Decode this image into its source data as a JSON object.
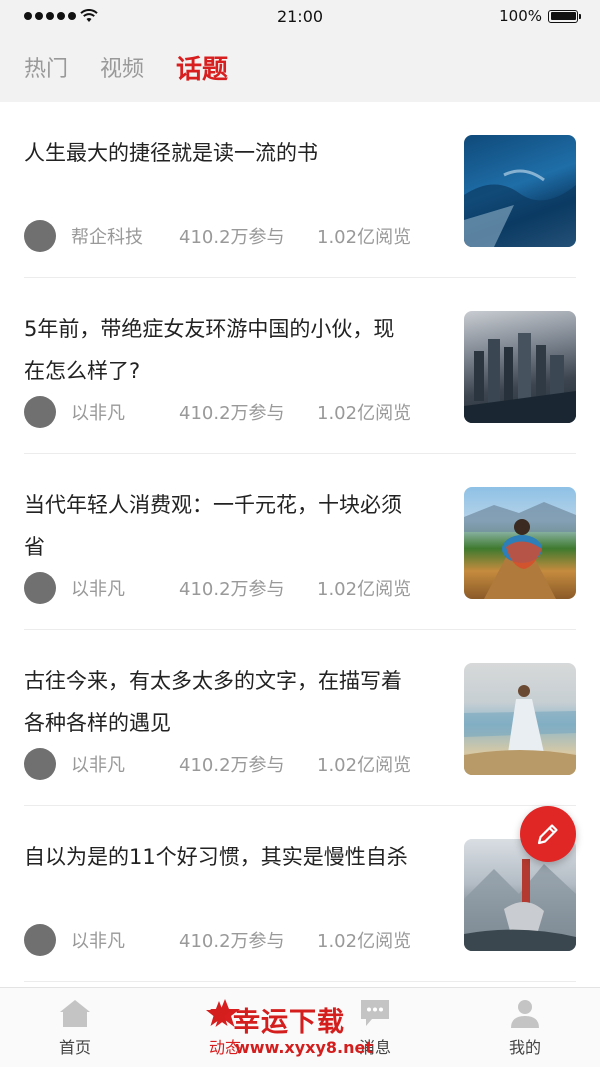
{
  "status_bar": {
    "time": "21:00",
    "battery": "100%"
  },
  "tabs": [
    {
      "label": "热门",
      "active": false
    },
    {
      "label": "视频",
      "active": false
    },
    {
      "label": "话题",
      "active": true
    }
  ],
  "topics": [
    {
      "title": "人生最大的捷径就是读一流的书",
      "author": "帮企科技",
      "participants": "410.2万参与",
      "views": "1.02亿阅览",
      "thumb": "blue-glacier-photo"
    },
    {
      "title": "5年前，带绝症女友环游中国的小伙，现在怎么样了?",
      "author": "以非凡",
      "participants": "410.2万参与",
      "views": "1.02亿阅览",
      "thumb": "city-skyline-photo"
    },
    {
      "title": "当代年轻人消费观：一千元花，十块必须省",
      "author": "以非凡",
      "participants": "410.2万参与",
      "views": "1.02亿阅览",
      "thumb": "woman-on-bridge-photo"
    },
    {
      "title": "古往今来，有太多太多的文字，在描写着各种各样的遇见",
      "author": "以非凡",
      "participants": "410.2万参与",
      "views": "1.02亿阅览",
      "thumb": "woman-at-beach-photo"
    },
    {
      "title": "自以为是的11个好习惯，其实是慢性自杀",
      "author": "以非凡",
      "participants": "410.2万参与",
      "views": "1.02亿阅览",
      "thumb": "mountain-figure-photo"
    }
  ],
  "fab": {
    "icon": "pencil-icon",
    "color": "#e12626"
  },
  "bottom_nav": [
    {
      "label": "首页",
      "icon": "home-icon",
      "active": false
    },
    {
      "label": "动态",
      "icon": "star-icon",
      "active": true
    },
    {
      "label": "消息",
      "icon": "message-icon",
      "active": false
    },
    {
      "label": "我的",
      "icon": "user-icon",
      "active": false
    }
  ],
  "watermark": {
    "text": "幸运下载",
    "url": "www.xyxy8.net"
  },
  "colors": {
    "accent": "#d81e1e",
    "muted": "#999999"
  }
}
